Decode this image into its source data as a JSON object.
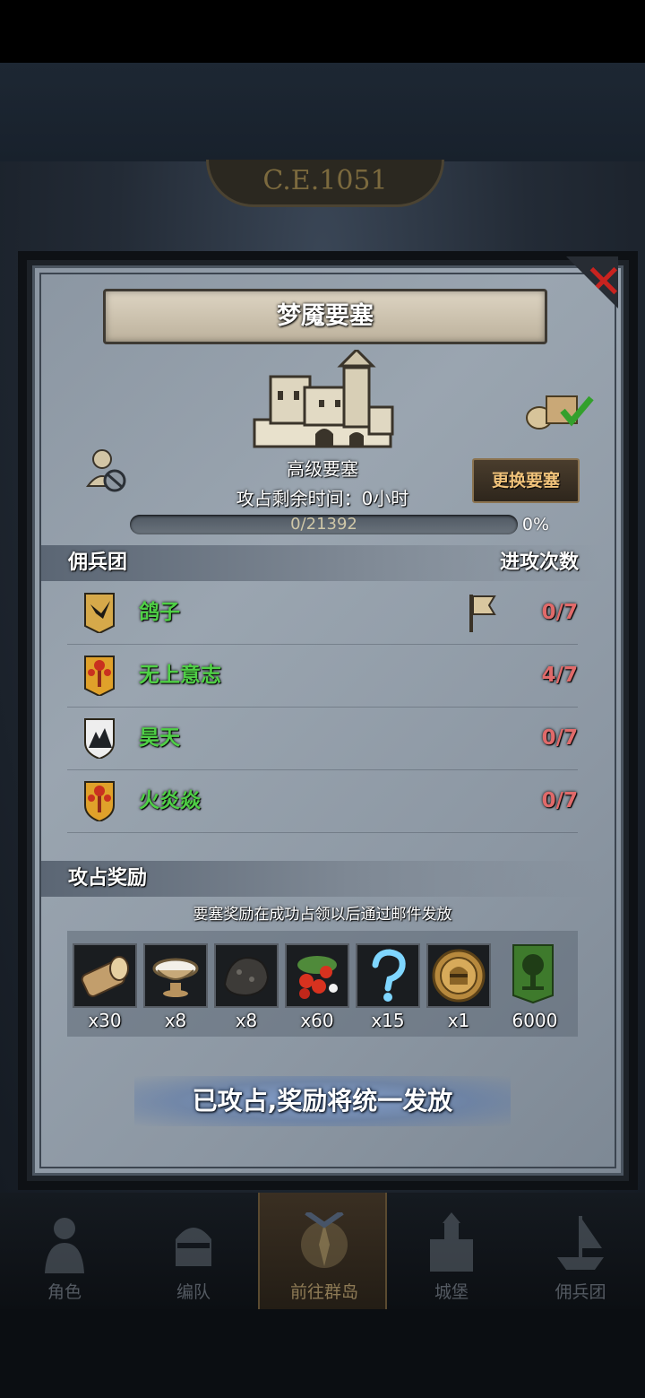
{
  "background": {
    "era_label": "C.E.1051"
  },
  "dialog": {
    "title": "梦魇要塞",
    "close_icon": "close-x-icon",
    "fortress_type": "高级要塞",
    "time_label": "攻占剩余时间：",
    "time_value": "0小时",
    "swap_button": "更换要塞",
    "progress": {
      "text": "0/21392",
      "percent_label": "0%",
      "value": 0
    },
    "mercenary_header": {
      "left": "佣兵团",
      "right": "进攻次数"
    },
    "mercenaries": [
      {
        "name": "鸽子",
        "count": "0/7",
        "emblem": "bird-banner-icon",
        "has_flag": true
      },
      {
        "name": "无上意志",
        "count": "4/7",
        "emblem": "torch-banner-icon",
        "has_flag": false
      },
      {
        "name": "昊天",
        "count": "0/7",
        "emblem": "mountain-shield-icon",
        "has_flag": false
      },
      {
        "name": "火炎焱",
        "count": "0/7",
        "emblem": "torch-banner-icon",
        "has_flag": false
      }
    ],
    "rewards_header": "攻占奖励",
    "reward_note": "要塞奖励在成功占领以后通过邮件发放",
    "rewards": [
      {
        "icon": "wood-log-icon",
        "qty": "x30"
      },
      {
        "icon": "bowl-icon",
        "qty": "x8"
      },
      {
        "icon": "ore-icon",
        "qty": "x8"
      },
      {
        "icon": "berries-icon",
        "qty": "x60"
      },
      {
        "icon": "mystery-question-icon",
        "qty": "x15"
      },
      {
        "icon": "knight-helmet-coin-icon",
        "qty": "x1"
      },
      {
        "icon": "tree-banner-icon",
        "qty": "6000"
      }
    ],
    "status_bar": "已攻占,奖励将统一发放"
  },
  "nav": [
    {
      "label": "角色",
      "icon": "knight-icon",
      "active": false
    },
    {
      "label": "编队",
      "icon": "helmet-icon",
      "active": false
    },
    {
      "label": "前往群岛",
      "icon": "compass-icon",
      "active": true
    },
    {
      "label": "城堡",
      "icon": "castle-icon",
      "active": false
    },
    {
      "label": "佣兵团",
      "icon": "ship-icon",
      "active": false
    }
  ],
  "colors": {
    "name_green": "#4fcf46",
    "count_red": "#e06a6a",
    "accent_gold": "#f0c27a",
    "close_red": "#c9231f"
  }
}
